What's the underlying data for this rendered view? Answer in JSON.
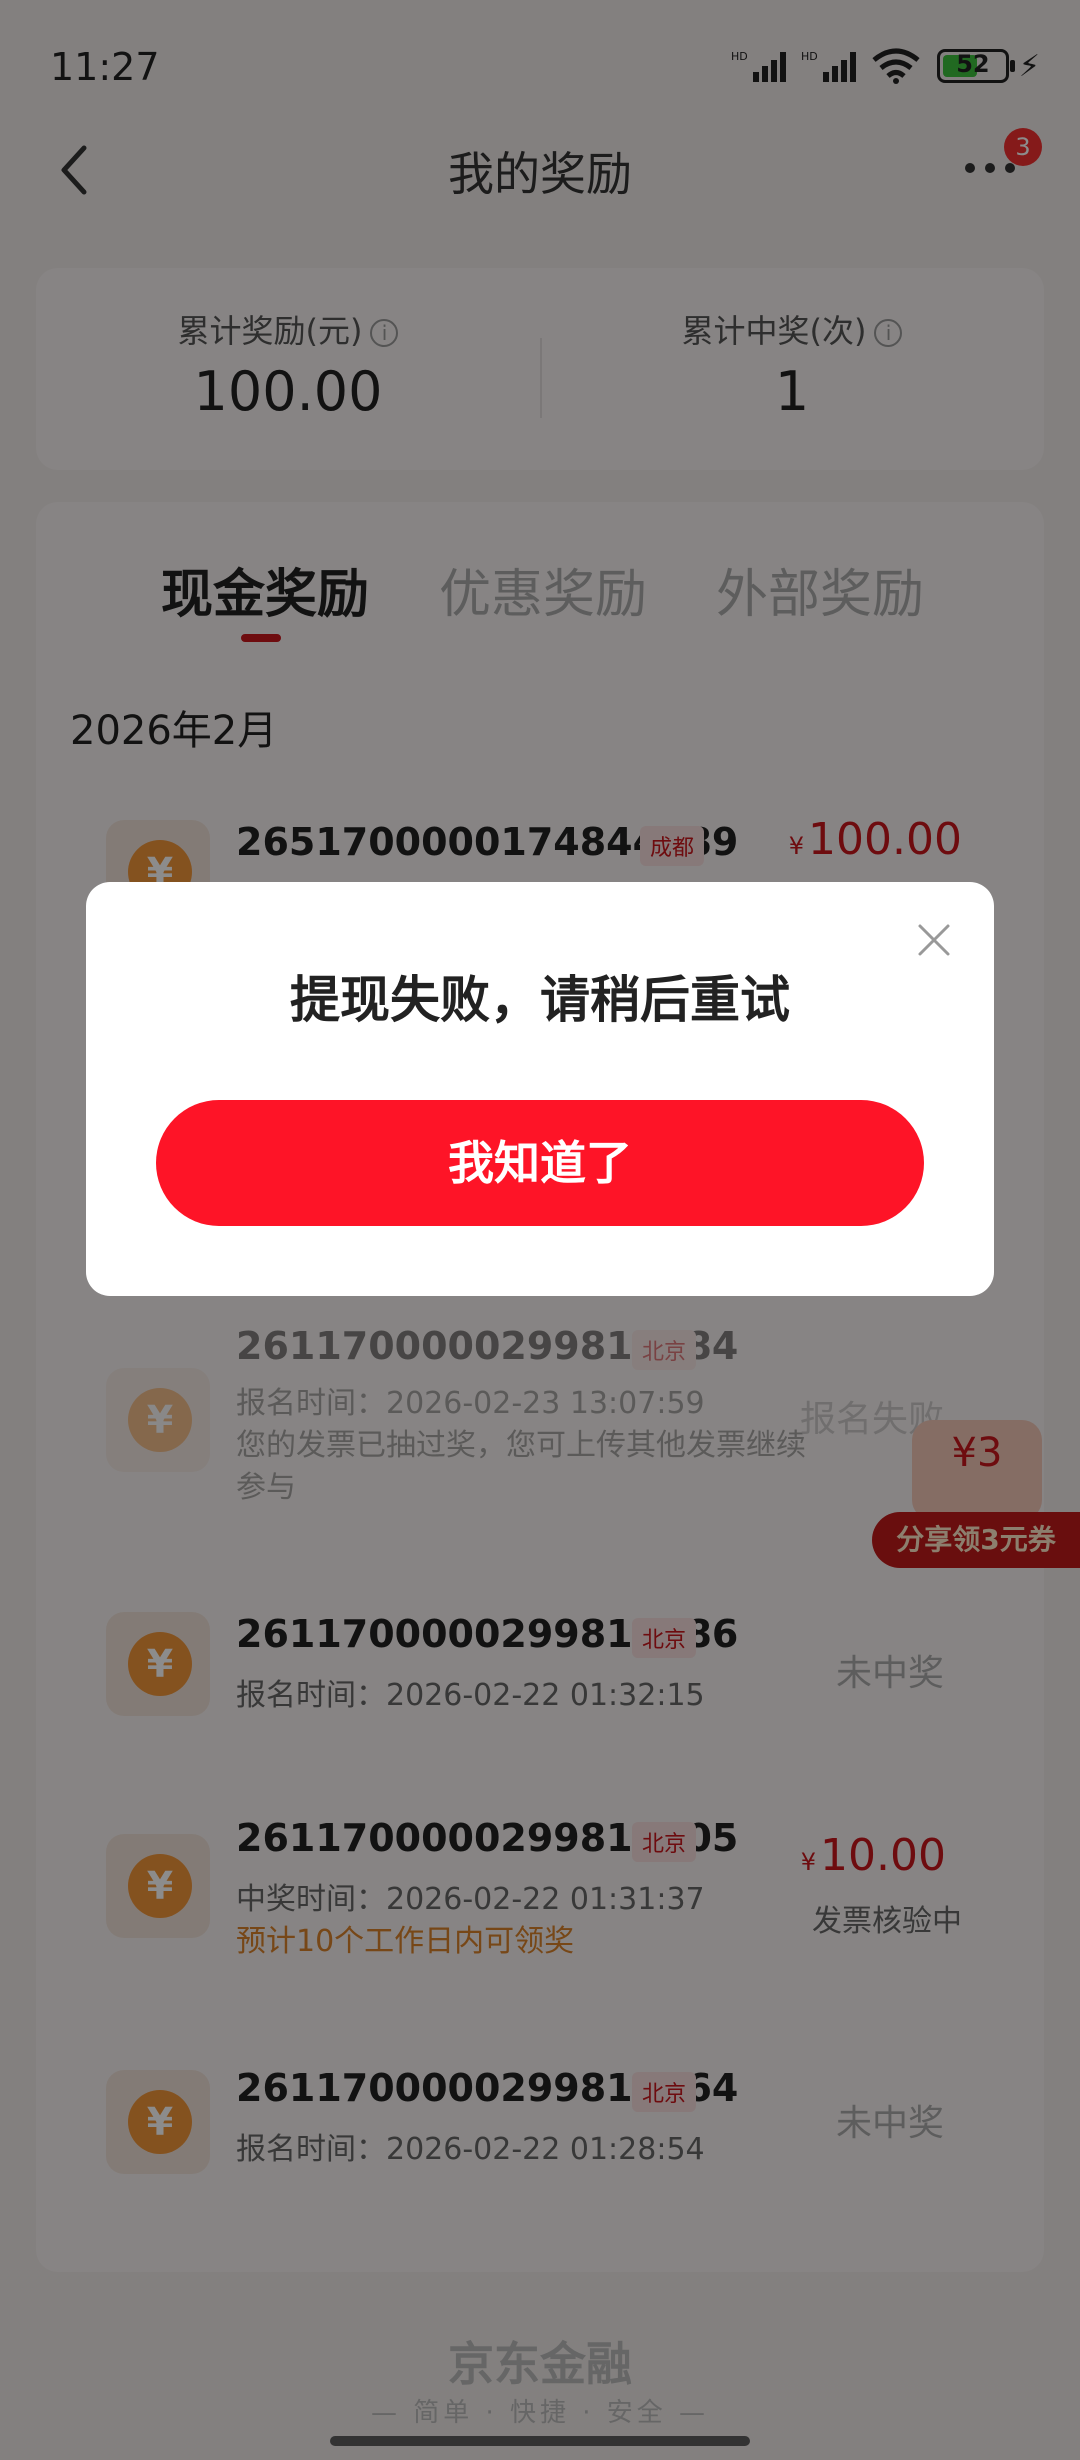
{
  "status_bar": {
    "time": "11:27",
    "battery": "52"
  },
  "nav": {
    "title": "我的奖励",
    "badge": "3"
  },
  "stats": {
    "total_reward_label": "累计奖励(元)",
    "total_reward_value": "100.00",
    "total_wins_label": "累计中奖(次)",
    "total_wins_value": "1"
  },
  "tabs": [
    "现金奖励",
    "优惠奖励",
    "外部奖励"
  ],
  "month": "2026年2月",
  "records": [
    {
      "id": "2651700000174844089",
      "city": "成都",
      "amount_symbol": "¥",
      "amount": "100.00"
    },
    {
      "id": "2611700000299811984",
      "city": "北京",
      "line1": "报名时间：2026-02-23 13:07:59",
      "line2": "您的发票已抽过奖，您可上传其他发票继续",
      "line3": "参与",
      "status": "报名失败"
    },
    {
      "id": "2611700000299811486",
      "city": "北京",
      "line1": "报名时间：2026-02-22 01:32:15",
      "status": "未中奖"
    },
    {
      "id": "2611700000299811505",
      "city": "北京",
      "line1": "中奖时间：2026-02-22 01:31:37",
      "warn": "预计10个工作日内可领奖",
      "amount_symbol": "¥",
      "amount": "10.00",
      "status_sub": "发票核验中"
    },
    {
      "id": "2611700000299810664",
      "city": "北京",
      "line1": "报名时间：2026-02-22 01:28:54",
      "status": "未中奖"
    }
  ],
  "promo": {
    "label": "分享领3元券",
    "gift_text": "¥3"
  },
  "footer": {
    "brand": "京东金融",
    "slogan": "— 简单 · 快捷 · 安全 —"
  },
  "dialog": {
    "message": "提现失败，请稍后重试",
    "button": "我知道了"
  }
}
